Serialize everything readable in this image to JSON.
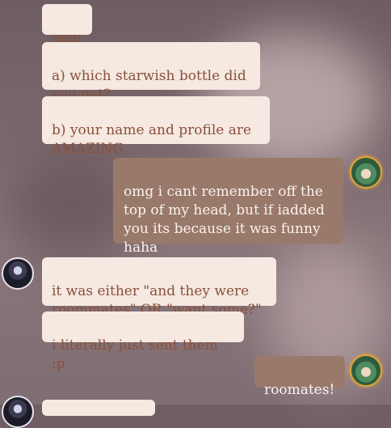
{
  "messages": [
    {
      "side": "in",
      "text": "omg"
    },
    {
      "side": "in",
      "text": "a) which starwish bottle did you get?"
    },
    {
      "side": "in",
      "text": "b) your name and profile are AMAZING"
    },
    {
      "side": "out",
      "text": "omg i cant remember off the top of my head, but if iadded you its because it was funny haha"
    },
    {
      "side": "in",
      "text": "it was either \"and they were roommates\" OR \"want some?\""
    },
    {
      "side": "in",
      "text": "i literally just sent them :p"
    },
    {
      "side": "out",
      "text": "roomates!"
    }
  ],
  "avatars": {
    "left_icon": "user-avatar-silver-hair",
    "right_icon": "user-avatar-green-hair"
  },
  "colors": {
    "incoming_bubble": "#f5e9e2",
    "incoming_text": "#8a5038",
    "outgoing_bubble": "#99796a",
    "outgoing_text": "#fbf3ee"
  }
}
